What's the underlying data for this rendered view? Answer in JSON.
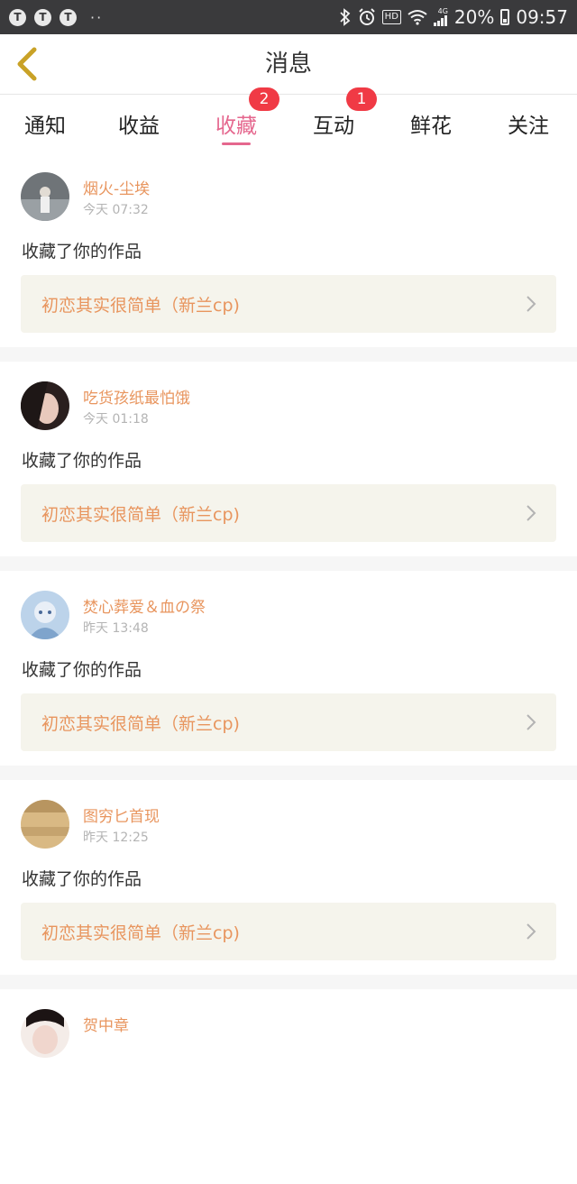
{
  "status_bar": {
    "left_icons": [
      "T",
      "T",
      "T"
    ],
    "dots": "··",
    "network": "4G",
    "battery_percent": "20%",
    "time": "09:57",
    "hd_label": "HD"
  },
  "nav": {
    "title": "消息"
  },
  "tabs": [
    {
      "label": "通知",
      "badge": ""
    },
    {
      "label": "收益",
      "badge": ""
    },
    {
      "label": "收藏",
      "badge": "2",
      "active": true
    },
    {
      "label": "互动",
      "badge": "1"
    },
    {
      "label": "鲜花",
      "badge": ""
    },
    {
      "label": "关注",
      "badge": ""
    }
  ],
  "items": [
    {
      "username": "烟火-尘埃",
      "time": "今天 07:32",
      "action": "收藏了你的作品",
      "work": "初恋其实很简单（新兰cp)"
    },
    {
      "username": "吃货孩纸最怕饿",
      "time": "今天 01:18",
      "action": "收藏了你的作品",
      "work": "初恋其实很简单（新兰cp)"
    },
    {
      "username": "焚心葬爱＆血の祭",
      "time": "昨天 13:48",
      "action": "收藏了你的作品",
      "work": "初恋其实很简单（新兰cp)"
    },
    {
      "username": "图穷匕首现",
      "time": "昨天 12:25",
      "action": "收藏了你的作品",
      "work": "初恋其实很简单（新兰cp)"
    },
    {
      "username": "贺中章",
      "time": "",
      "action": "",
      "work": ""
    }
  ],
  "colors": {
    "accent": "#e5678e",
    "badge": "#f03a45",
    "username": "#e8955e",
    "work_bg": "#f5f4ec"
  }
}
